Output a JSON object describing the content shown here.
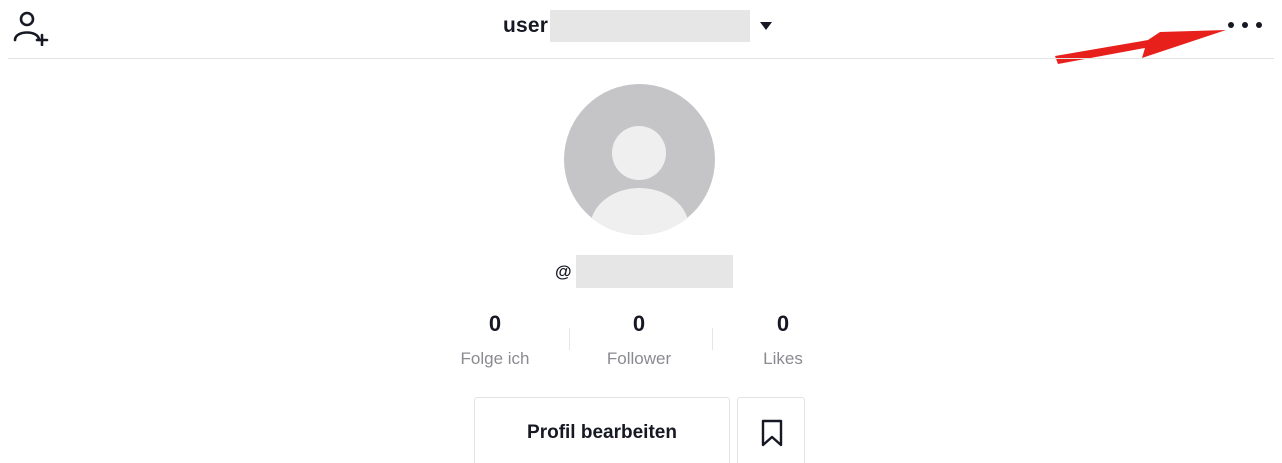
{
  "header": {
    "title_prefix": "user",
    "add_user_icon": "add-user-icon",
    "dropdown_icon": "caret-down-icon",
    "more_icon": "more-dots-icon"
  },
  "annotation": {
    "arrow_color": "#e8201b"
  },
  "profile": {
    "avatar_icon": "default-avatar",
    "handle_prefix": "@",
    "stats": [
      {
        "value": "0",
        "label": "Folge ich"
      },
      {
        "value": "0",
        "label": "Follower"
      },
      {
        "value": "0",
        "label": "Likes"
      }
    ],
    "edit_button_label": "Profil bearbeiten",
    "bookmark_icon": "bookmark-icon"
  },
  "colors": {
    "text_primary": "#161823",
    "text_secondary": "#8a8b91",
    "avatar_bg": "#c5c5c8",
    "redaction": "#e6e6e6"
  }
}
